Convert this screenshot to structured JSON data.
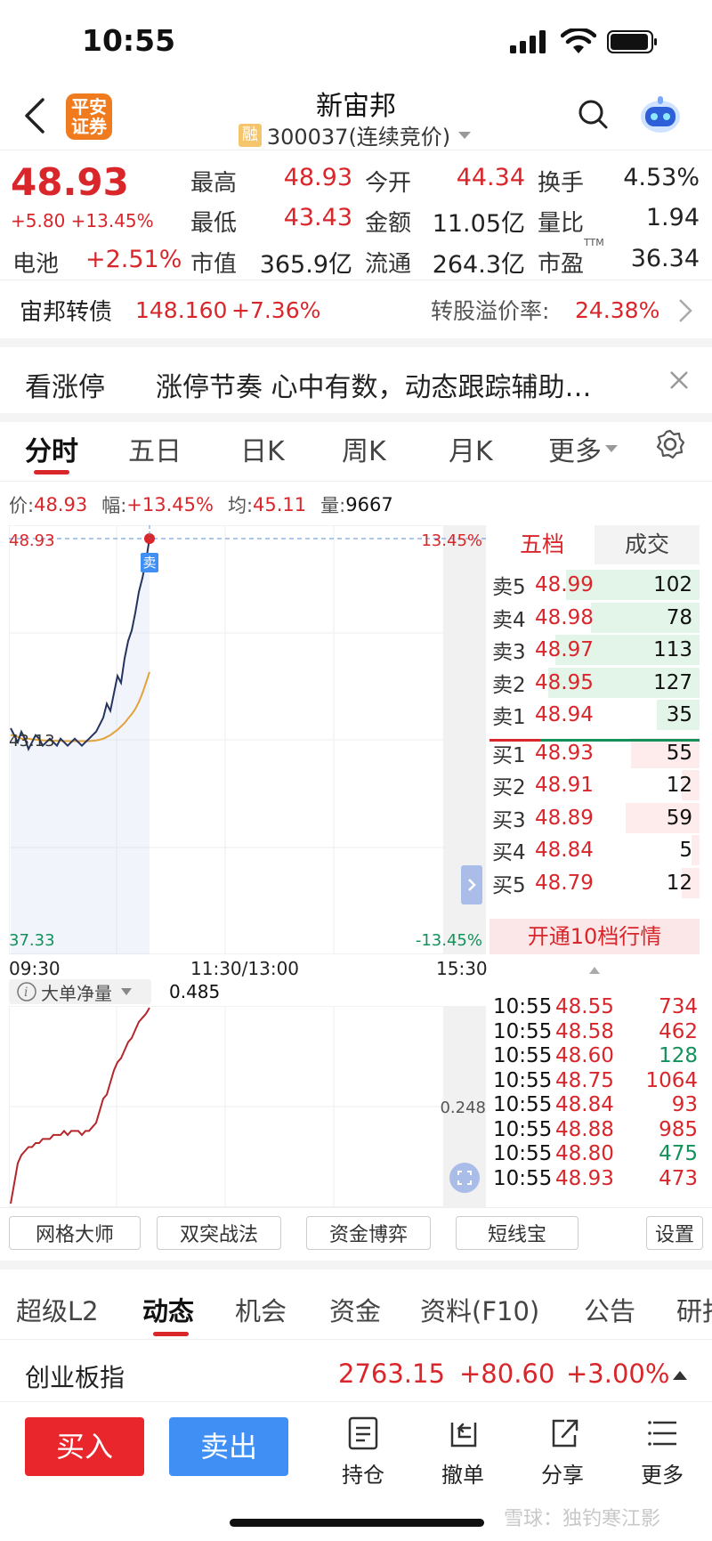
{
  "status_bar": {
    "time": "10:55"
  },
  "header": {
    "logo_text": "平安证券",
    "logo_line1": "平安",
    "logo_line2": "证券",
    "name": "新宙邦",
    "rong_badge": "融",
    "code": "300037(连续竞价)"
  },
  "quote": {
    "price": "48.93",
    "change": "+5.80 +13.45%",
    "sector_name": "电池",
    "sector_change": "+2.51%",
    "fields": [
      {
        "label": "最高",
        "value": "48.93"
      },
      {
        "label": "今开",
        "value": "44.34"
      },
      {
        "label": "换手",
        "value": "4.53%"
      },
      {
        "label": "最低",
        "value": "43.43"
      },
      {
        "label": "金额",
        "value": "11.05亿"
      },
      {
        "label": "量比",
        "value": "1.94"
      },
      {
        "label": "市值",
        "value": "365.9亿"
      },
      {
        "label": "流通",
        "value": "264.3亿"
      },
      {
        "label": "市盈",
        "value": "36.34"
      }
    ],
    "pe_superscript": "TTM"
  },
  "bond": {
    "name": "宙邦转债",
    "price": "148.160",
    "change": "+7.36%",
    "premium_label": "转股溢价率:",
    "premium_value": "24.38%"
  },
  "banner": {
    "title": "看涨停",
    "text": "涨停节奏 心中有数，动态跟踪辅助…"
  },
  "chart_tabs": [
    "分时",
    "五日",
    "日K",
    "周K",
    "月K",
    "更多"
  ],
  "info_line": {
    "price_label": "价:",
    "price": "48.93",
    "range_label": "幅:",
    "range": "+13.45%",
    "avg_label": "均:",
    "avg": "45.11",
    "vol_label": "量:",
    "vol": "9667"
  },
  "chart_data": {
    "type": "line",
    "y_labels_left": [
      "48.93",
      "43.13",
      "37.33"
    ],
    "y_labels_right": [
      "13.45%",
      "-13.45%"
    ],
    "x_labels": [
      "09:30",
      "11:30/13:00",
      "15:30"
    ],
    "ylim": [
      37.33,
      48.93
    ],
    "sell_marker": "卖",
    "price_series": [
      43.5,
      43.3,
      43.1,
      43.4,
      43.2,
      42.9,
      43.1,
      43.3,
      43.2,
      43.0,
      43.1,
      43.2,
      43.1,
      43.0,
      43.2,
      43.1,
      43.0,
      43.1,
      43.2,
      43.1,
      43.0,
      43.1,
      43.2,
      43.3,
      43.4,
      43.6,
      43.8,
      44.2,
      44.0,
      44.5,
      45.0,
      44.8,
      45.5,
      46.0,
      46.3,
      46.8,
      47.4,
      47.8,
      48.3,
      48.93
    ],
    "avg_series": [
      43.3,
      43.3,
      43.25,
      43.2,
      43.2,
      43.2,
      43.18,
      43.17,
      43.16,
      43.15,
      43.15,
      43.15,
      43.14,
      43.14,
      43.14,
      43.13,
      43.13,
      43.13,
      43.13,
      43.13,
      43.13,
      43.13,
      43.13,
      43.14,
      43.15,
      43.17,
      43.2,
      43.25,
      43.3,
      43.38,
      43.45,
      43.55,
      43.65,
      43.78,
      43.9,
      44.05,
      44.25,
      44.5,
      44.8,
      45.11
    ],
    "indicator": {
      "name": "大单净量",
      "value": "0.485",
      "mid_label": "0.248",
      "series": [
        0.0,
        0.05,
        0.1,
        0.12,
        0.13,
        0.14,
        0.14,
        0.15,
        0.15,
        0.16,
        0.16,
        0.16,
        0.17,
        0.17,
        0.17,
        0.18,
        0.17,
        0.18,
        0.18,
        0.18,
        0.17,
        0.18,
        0.18,
        0.19,
        0.2,
        0.23,
        0.26,
        0.27,
        0.3,
        0.33,
        0.35,
        0.36,
        0.38,
        0.4,
        0.41,
        0.43,
        0.45,
        0.46,
        0.47,
        0.485
      ],
      "ylim": [
        0,
        0.485
      ]
    }
  },
  "order_book": {
    "tabs": [
      "五档",
      "成交"
    ],
    "asks": [
      {
        "label": "卖5",
        "price": "48.99",
        "vol": "102",
        "ratio": 0.88
      },
      {
        "label": "卖4",
        "price": "48.98",
        "vol": "78",
        "ratio": 0.72
      },
      {
        "label": "卖3",
        "price": "48.97",
        "vol": "113",
        "ratio": 0.95
      },
      {
        "label": "卖2",
        "price": "48.95",
        "vol": "127",
        "ratio": 1.0
      },
      {
        "label": "卖1",
        "price": "48.94",
        "vol": "35",
        "ratio": 0.28
      }
    ],
    "bids": [
      {
        "label": "买1",
        "price": "48.93",
        "vol": "55",
        "ratio": 0.45
      },
      {
        "label": "买2",
        "price": "48.91",
        "vol": "12",
        "ratio": 0.12
      },
      {
        "label": "买3",
        "price": "48.89",
        "vol": "59",
        "ratio": 0.49
      },
      {
        "label": "买4",
        "price": "48.84",
        "vol": "5",
        "ratio": 0.05
      },
      {
        "label": "买5",
        "price": "48.79",
        "vol": "12",
        "ratio": 0.12
      }
    ],
    "open_10": "开通10档行情"
  },
  "ticks": [
    {
      "time": "10:55",
      "price": "48.55",
      "vol": "734",
      "dir": "red"
    },
    {
      "time": "10:55",
      "price": "48.58",
      "vol": "462",
      "dir": "red"
    },
    {
      "time": "10:55",
      "price": "48.60",
      "vol": "128",
      "dir": "green"
    },
    {
      "time": "10:55",
      "price": "48.75",
      "vol": "1064",
      "dir": "red"
    },
    {
      "time": "10:55",
      "price": "48.84",
      "vol": "93",
      "dir": "red"
    },
    {
      "time": "10:55",
      "price": "48.88",
      "vol": "985",
      "dir": "red"
    },
    {
      "time": "10:55",
      "price": "48.80",
      "vol": "475",
      "dir": "green"
    },
    {
      "time": "10:55",
      "price": "48.93",
      "vol": "473",
      "dir": "red"
    }
  ],
  "tools": [
    "网格大师",
    "双突战法",
    "资金博弈",
    "短线宝",
    "设置"
  ],
  "bottom_tabs": [
    "超级L2",
    "动态",
    "机会",
    "资金",
    "资料(F10)",
    "公告",
    "研报"
  ],
  "index_bar": {
    "name": "创业板指",
    "value": "2763.15",
    "change": "+80.60",
    "pct": "+3.00%"
  },
  "actions": {
    "buy": "买入",
    "sell": "卖出",
    "position": "持仓",
    "cancel": "撤单",
    "share": "分享",
    "more": "更多"
  },
  "watermark": "雪球：独钓寒江影",
  "colors": {
    "up": "#d9262b",
    "down": "#12925a",
    "accent": "#3f8ff5",
    "buy_btn": "#e8262b",
    "sell_btn": "#3f8ff5"
  }
}
